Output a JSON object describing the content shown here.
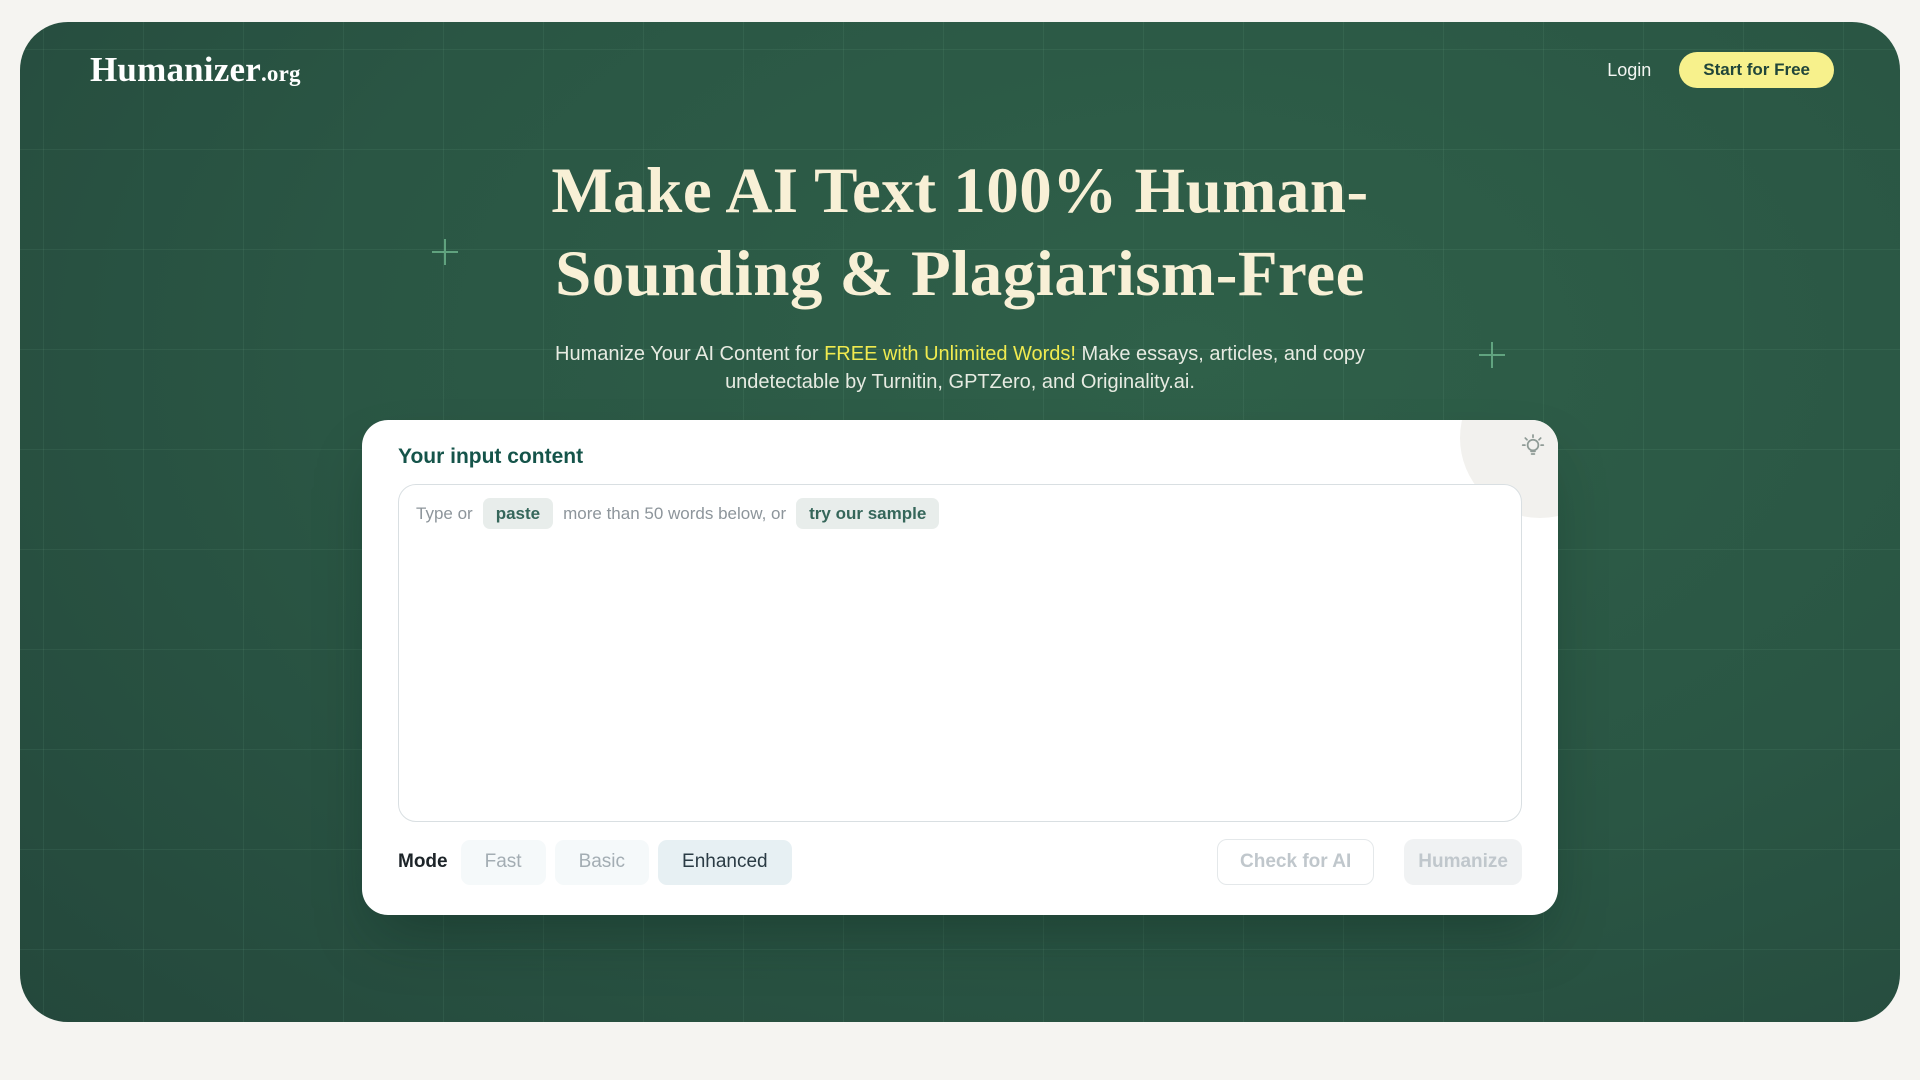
{
  "brand": {
    "name": "Humanizer",
    "tld": ".org"
  },
  "header": {
    "login_label": "Login",
    "cta_label": "Start for Free"
  },
  "hero": {
    "title_line1": "Make AI Text 100% Human-",
    "title_line2": "Sounding & Plagiarism-Free",
    "subtitle_prefix": "Humanize Your AI Content for ",
    "subtitle_highlight": "FREE with Unlimited Words!",
    "subtitle_suffix": " Make essays, articles, and copy undetectable by Turnitin, GPTZero, and Originality.ai."
  },
  "card": {
    "title": "Your input content",
    "placeholder": {
      "part1": "Type or",
      "paste_chip": "paste",
      "part2": "more than 50 words below, or",
      "sample_chip": "try our sample"
    },
    "mode": {
      "label": "Mode",
      "options": [
        {
          "label": "Fast",
          "selected": false
        },
        {
          "label": "Basic",
          "selected": false
        },
        {
          "label": "Enhanced",
          "selected": true
        }
      ]
    },
    "actions": {
      "check_label": "Check for AI",
      "humanize_label": "Humanize"
    }
  },
  "icons": {
    "lightbulb": "lightbulb-tips-icon",
    "plus_marks": [
      "plus-decoration-icon",
      "plus-decoration-icon"
    ]
  },
  "colors": {
    "panel_green_light": "#2f6049",
    "panel_green_dark": "#203d34",
    "heading_cream": "#f8f0d6",
    "highlight_yellow": "#f0ea4f",
    "cta_yellow": "#f7f18c",
    "cta_text_green": "#21463a",
    "card_title_teal": "#15544a",
    "chip_bg": "#e8edeb",
    "chip_text": "#35665a",
    "mode_selected_bg": "#e7f0f3",
    "disabled_text": "#c0c7cc",
    "outer_bg": "#f5f4f1"
  }
}
